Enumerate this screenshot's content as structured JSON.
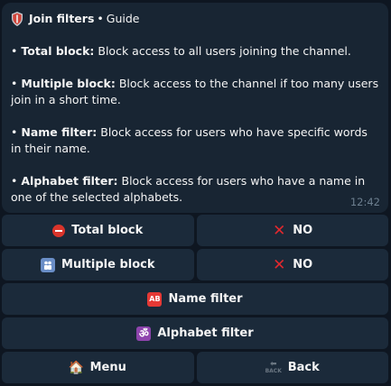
{
  "message": {
    "title": "Join filters",
    "separator": "•",
    "subtitle": "Guide",
    "items": [
      {
        "term": "Total block:",
        "desc": " Block access to all users joining the channel."
      },
      {
        "term": "Multiple block:",
        "desc": " Block access to the channel if too many users join in a short time."
      },
      {
        "term": "Name filter:",
        "desc": " Block access for users who have specific words in their name."
      },
      {
        "term": "Alphabet filter:",
        "desc": " Block access for users who have a name in one of the selected alphabets."
      }
    ],
    "bullet": "•",
    "time": "12:42"
  },
  "keyboard": {
    "total_block": {
      "label": "Total block",
      "icon": "no-entry-icon"
    },
    "total_block_value": {
      "label": "NO",
      "icon": "cross-mark-icon"
    },
    "multiple_block": {
      "label": "Multiple block",
      "icon": "people-icon"
    },
    "multiple_block_value": {
      "label": "NO",
      "icon": "cross-mark-icon"
    },
    "name_filter": {
      "label": "Name filter",
      "icon": "ab-button-icon",
      "icon_text": "AB"
    },
    "alphabet_filter": {
      "label": "Alphabet filter",
      "icon": "om-icon",
      "icon_text": "ॐ"
    },
    "menu": {
      "label": "Menu",
      "icon": "house-icon",
      "icon_text": "🏠"
    },
    "back": {
      "label": "Back",
      "icon": "back-arrow-icon",
      "icon_text": "BACK"
    }
  },
  "colors": {
    "background": "#0e1621",
    "bubble": "#182533",
    "button": "#1b2a3a",
    "cross": "#e0282e"
  }
}
